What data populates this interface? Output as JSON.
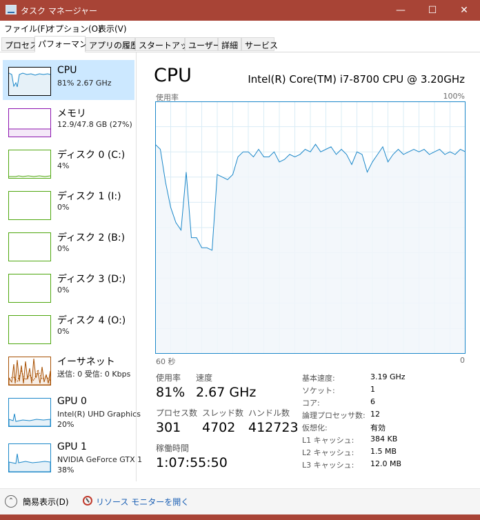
{
  "window": {
    "title": "タスク マネージャー",
    "minimize_icon": "minimize-icon",
    "maximize_icon": "maximize-icon",
    "close_icon": "close-icon",
    "accent": "#a84436"
  },
  "menu": [
    "ファイル(F)",
    "オプション(O)",
    "表示(V)"
  ],
  "tabs": [
    "プロセス",
    "パフォーマンス",
    "アプリの履歴",
    "スタートアップ",
    "ユーザー",
    "詳細",
    "サービス"
  ],
  "sidebar": [
    {
      "name": "CPU",
      "detail": "81%  2.67 GHz",
      "color": "#1a87c9",
      "fill": "#e6f1f8"
    },
    {
      "name": "メモリ",
      "detail": "12.9/47.8 GB (27%)",
      "color": "#8b12ae",
      "fill": "#f4e8f8"
    },
    {
      "name": "ディスク 0 (C:)",
      "detail": "4%",
      "color": "#4da60c",
      "fill": "#eff7e8"
    },
    {
      "name": "ディスク 1 (I:)",
      "detail": "0%",
      "color": "#4da60c",
      "fill": "#eff7e8"
    },
    {
      "name": "ディスク 2 (B:)",
      "detail": "0%",
      "color": "#4da60c",
      "fill": "#eff7e8"
    },
    {
      "name": "ディスク 3 (D:)",
      "detail": "0%",
      "color": "#4da60c",
      "fill": "#eff7e8"
    },
    {
      "name": "ディスク 4 (O:)",
      "detail": "0%",
      "color": "#4da60c",
      "fill": "#eff7e8"
    },
    {
      "name": "イーサネット",
      "detail": "送信: 0 受信: 0 Kbps",
      "color": "#a74f01",
      "fill": "#f8ede4"
    },
    {
      "name": "GPU 0",
      "detail": "Intel(R) UHD Graphics",
      "detail2": "20%",
      "color": "#1a87c9",
      "fill": "#e6f1f8"
    },
    {
      "name": "GPU 1",
      "detail": "NVIDIA GeForce GTX 1",
      "detail2": "38%",
      "color": "#1a87c9",
      "fill": "#e6f1f8"
    }
  ],
  "main": {
    "title": "CPU",
    "model": "Intel(R) Core(TM) i7-8700 CPU @ 3.20GHz",
    "y_label": "使用率",
    "y_max": "100%",
    "x_left": "60 秒",
    "x_right": "0"
  },
  "stats": {
    "usage_label": "使用率",
    "usage_value": "81%",
    "speed_label": "速度",
    "speed_value": "2.67 GHz",
    "processes_label": "プロセス数",
    "processes_value": "301",
    "threads_label": "スレッド数",
    "threads_value": "4702",
    "handles_label": "ハンドル数",
    "handles_value": "412723",
    "uptime_label": "稼働時間",
    "uptime_value": "1:07:55:50"
  },
  "info": [
    {
      "label": "基本速度:",
      "value": "3.19 GHz"
    },
    {
      "label": "ソケット:",
      "value": "1"
    },
    {
      "label": "コア:",
      "value": "6"
    },
    {
      "label": "論理プロセッサ数:",
      "value": "12"
    },
    {
      "label": "仮想化:",
      "value": "有効"
    },
    {
      "label": "L1 キャッシュ:",
      "value": "384 KB"
    },
    {
      "label": "L2 キャッシュ:",
      "value": "1.5 MB"
    },
    {
      "label": "L3 キャッシュ:",
      "value": "12.0 MB"
    }
  ],
  "footer": {
    "fewer_details": "簡易表示(D)",
    "resource_monitor": "リソース モニターを開く"
  },
  "chart_data": {
    "type": "area",
    "title": "CPU",
    "xlabel": "",
    "ylabel": "使用率",
    "xlim": [
      60,
      0
    ],
    "ylim": [
      0,
      100
    ],
    "grid": true,
    "x": [
      60,
      59,
      58,
      57,
      56,
      55,
      54,
      53,
      52,
      51,
      50,
      49,
      48,
      47,
      46,
      45,
      44,
      43,
      42,
      41,
      40,
      39,
      38,
      37,
      36,
      35,
      34,
      33,
      32,
      31,
      30,
      29,
      28,
      27,
      26,
      25,
      24,
      23,
      22,
      21,
      20,
      19,
      18,
      17,
      16,
      15,
      14,
      13,
      12,
      11,
      10,
      9,
      8,
      7,
      6,
      5,
      4,
      3,
      2,
      1,
      0
    ],
    "series": [
      {
        "values": [
          83,
          81,
          68,
          58,
          52,
          49,
          72,
          46,
          46,
          42,
          42,
          41,
          71,
          70,
          69,
          71,
          78,
          80,
          80,
          78,
          81,
          78,
          78,
          80,
          76,
          77,
          79,
          78,
          79,
          81,
          80,
          83,
          80,
          81,
          82,
          79,
          81,
          79,
          75,
          80,
          79,
          72,
          76,
          79,
          82,
          76,
          79,
          81,
          79,
          80,
          81,
          80,
          81,
          79,
          80,
          81,
          79,
          80,
          79,
          81,
          80
        ],
        "color": "#1a87c9",
        "fill": "#f1f6fa"
      }
    ]
  }
}
